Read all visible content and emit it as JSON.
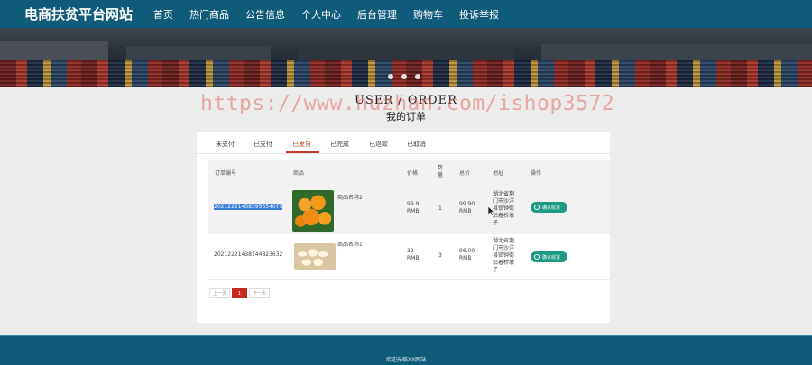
{
  "site": {
    "title": "电商扶贫平台网站"
  },
  "nav": {
    "items": [
      "首页",
      "热门商品",
      "公告信息",
      "个人中心",
      "后台管理",
      "购物车",
      "投诉举报"
    ]
  },
  "page": {
    "title_en": "USER / ORDER",
    "title_cn": "我的订单"
  },
  "watermark": "https://www.huzhan.com/ishop3572",
  "tabs": {
    "items": [
      "未支付",
      "已支付",
      "已发货",
      "已完成",
      "已退款",
      "已取消"
    ],
    "active_index": 2
  },
  "table": {
    "headers": [
      "订单编号",
      "商品",
      "价格",
      "数量",
      "总价",
      "地址",
      "操作"
    ],
    "rows": [
      {
        "order_no": "20212221438395354075",
        "product": "商品名称2",
        "price": "99.9",
        "price_unit": "RMB",
        "qty": "1",
        "total": "99.90",
        "total_unit": "RMB",
        "address": [
          "湖北省荆",
          "门市沙洋",
          "县锁钟街",
          "沿着桥墩",
          "子"
        ],
        "action": "确认收货",
        "image": "oranges"
      },
      {
        "order_no": "20212221438144823632",
        "product": "商品名称1",
        "price": "32",
        "price_unit": "RMB",
        "qty": "3",
        "total": "96.00",
        "total_unit": "RMB",
        "address": [
          "湖北省荆",
          "门市沙洋",
          "县锁钟街",
          "沿着桥墩",
          "子"
        ],
        "action": "确认收货",
        "image": "eggs"
      }
    ]
  },
  "pager": {
    "prev": "上一页",
    "current": "1",
    "next": "下一页"
  },
  "footer": {
    "text": "欢迎光临XX网站"
  },
  "colors": {
    "nav_bg": "#0e5b7a",
    "accent": "#c0392b",
    "button": "#1f9a82",
    "selection": "#3d7bd8"
  }
}
